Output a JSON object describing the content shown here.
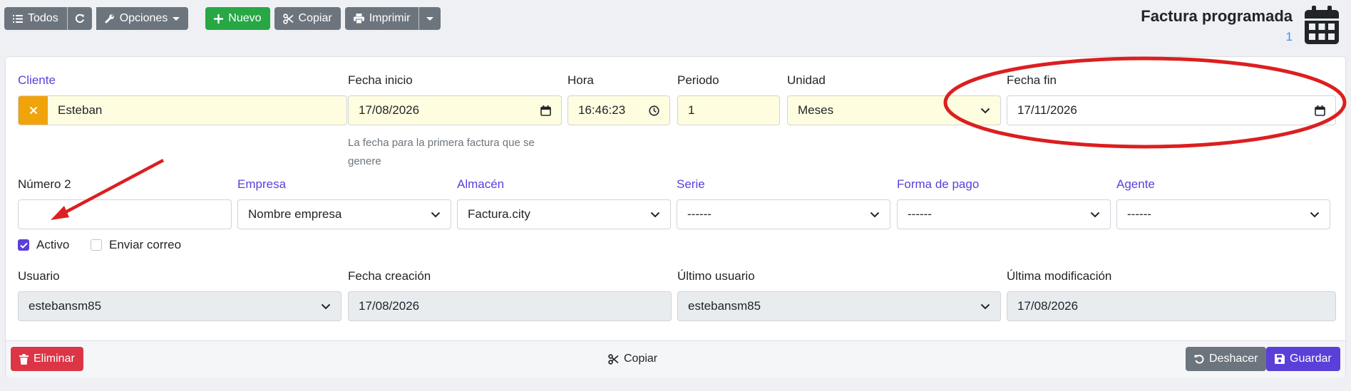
{
  "toolbar": {
    "todos_label": "Todos",
    "opciones_label": "Opciones",
    "nuevo_label": "Nuevo",
    "copiar_label": "Copiar",
    "imprimir_label": "Imprimir"
  },
  "header": {
    "title": "Factura programada",
    "count": "1"
  },
  "form": {
    "cliente": {
      "label": "Cliente",
      "value": "Esteban"
    },
    "fecha_inicio": {
      "label": "Fecha inicio",
      "value": "17/08/2026",
      "help": "La fecha para la primera factura que se genere"
    },
    "hora": {
      "label": "Hora",
      "value": "16:46:23"
    },
    "periodo": {
      "label": "Periodo",
      "value": "1"
    },
    "unidad": {
      "label": "Unidad",
      "value": "Meses"
    },
    "fecha_fin": {
      "label": "Fecha fin",
      "value": "17/11/2026"
    },
    "numero2": {
      "label": "Número 2",
      "value": ""
    },
    "empresa": {
      "label": "Empresa",
      "value": "Nombre empresa"
    },
    "almacen": {
      "label": "Almacén",
      "value": "Factura.city"
    },
    "serie": {
      "label": "Serie",
      "value": "------"
    },
    "forma_pago": {
      "label": "Forma de pago",
      "value": "------"
    },
    "agente": {
      "label": "Agente",
      "value": "------"
    },
    "activo": {
      "label": "Activo",
      "checked": true
    },
    "enviar_correo": {
      "label": "Enviar correo",
      "checked": false
    },
    "usuario": {
      "label": "Usuario",
      "value": "estebansm85"
    },
    "fecha_creacion": {
      "label": "Fecha creación",
      "value": "17/08/2026"
    },
    "ultimo_usuario": {
      "label": "Último usuario",
      "value": "estebansm85"
    },
    "ultima_modificacion": {
      "label": "Última modificación",
      "value": "17/08/2026"
    }
  },
  "footer": {
    "eliminar_label": "Eliminar",
    "copiar_label": "Copiar",
    "deshacer_label": "Deshacer",
    "guardar_label": "Guardar"
  },
  "colors": {
    "accent": "#5b3fd9",
    "annotation": "#dc1f1f",
    "required_bg": "#fffde0",
    "success": "#28a745",
    "danger": "#dc3545",
    "secondary": "#6c757d"
  },
  "icons": [
    "list-icon",
    "refresh-icon",
    "wrench-icon",
    "plus-icon",
    "scissors-icon",
    "printer-icon",
    "calendar-icon",
    "clock-icon",
    "chevron-down-icon",
    "close-icon",
    "check-icon",
    "trash-icon",
    "undo-icon",
    "save-icon"
  ]
}
